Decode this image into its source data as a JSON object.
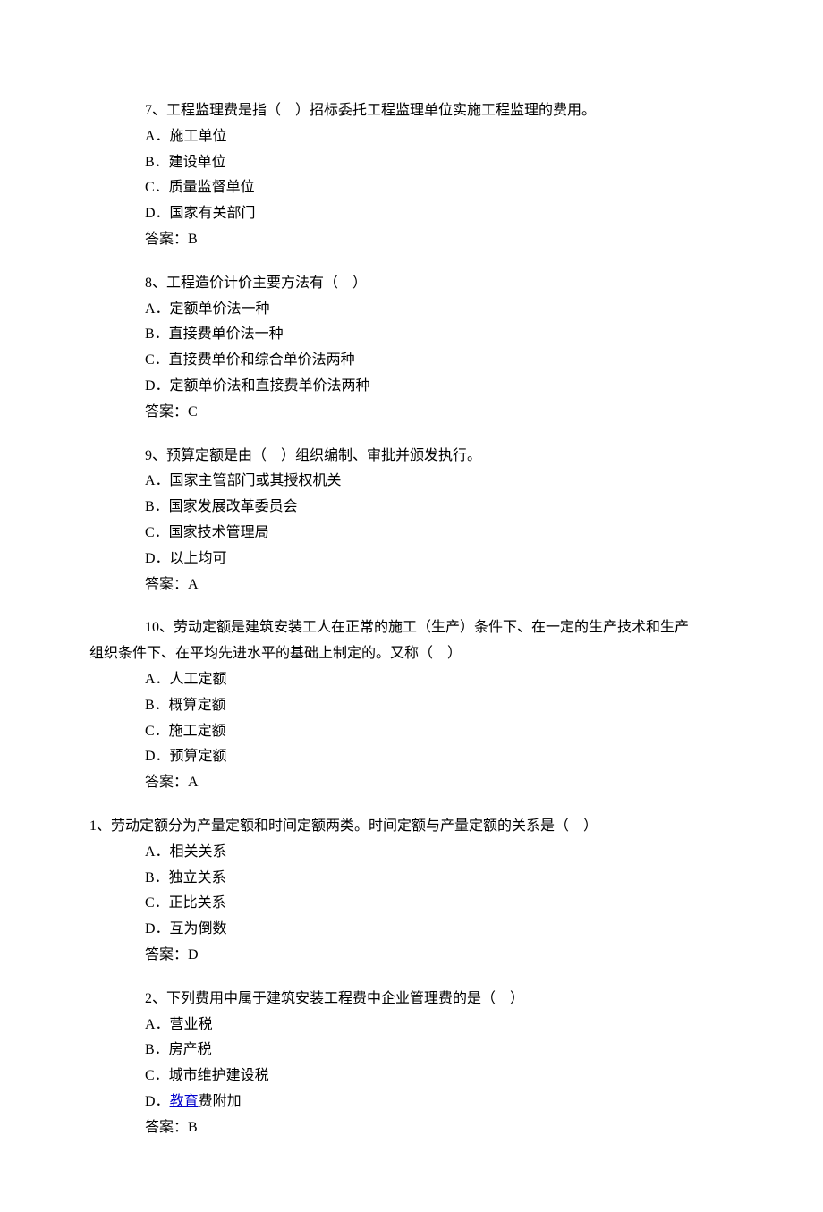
{
  "questions": [
    {
      "num": "7、",
      "stem": "工程监理费是指（　）招标委托工程监理单位实施工程监理的费用。",
      "options": [
        "A．施工单位",
        "B．建设单位",
        "C．质量监督单位",
        "D．国家有关部门"
      ],
      "answer": "答案：B"
    },
    {
      "num": "8、",
      "stem": "工程造价计价主要方法有（　）",
      "options": [
        "A．定额单价法一种",
        "B．直接费单价法一种",
        "C．直接费单价和综合单价法两种",
        "D．定额单价法和直接费单价法两种"
      ],
      "answer": "答案：C"
    },
    {
      "num": "9、",
      "stem": "预算定额是由（　）组织编制、审批并颁发执行。",
      "options": [
        "A．国家主管部门或其授权机关",
        "B．国家发展改革委员会",
        "C．国家技术管理局",
        "D．以上均可"
      ],
      "answer": "答案：A"
    },
    {
      "num": "10、",
      "stem_line1": "劳动定额是建筑安装工人在正常的施工（生产）条件下、在一定的生产技术和生产",
      "stem_line2": "组织条件下、在平均先进水平的基础上制定的。又称（　）",
      "options": [
        "A．人工定额",
        "B．概算定额",
        "C．施工定额",
        "D．预算定额"
      ],
      "answer": "答案：A"
    },
    {
      "num": "1、",
      "stem": "劳动定额分为产量定额和时间定额两类。时间定额与产量定额的关系是（　）",
      "options": [
        "A．相关关系",
        "B．独立关系",
        "C．正比关系",
        "D．互为倒数"
      ],
      "answer": "答案：D"
    },
    {
      "num": "2、",
      "stem": "下列费用中属于建筑安装工程费中企业管理费的是（　）",
      "options": [
        "A．营业税",
        "B．房产税",
        "C．城市维护建设税"
      ],
      "optionD_prefix": "D．",
      "optionD_link": "教育",
      "optionD_suffix": "费附加",
      "answer": "答案：B"
    }
  ]
}
